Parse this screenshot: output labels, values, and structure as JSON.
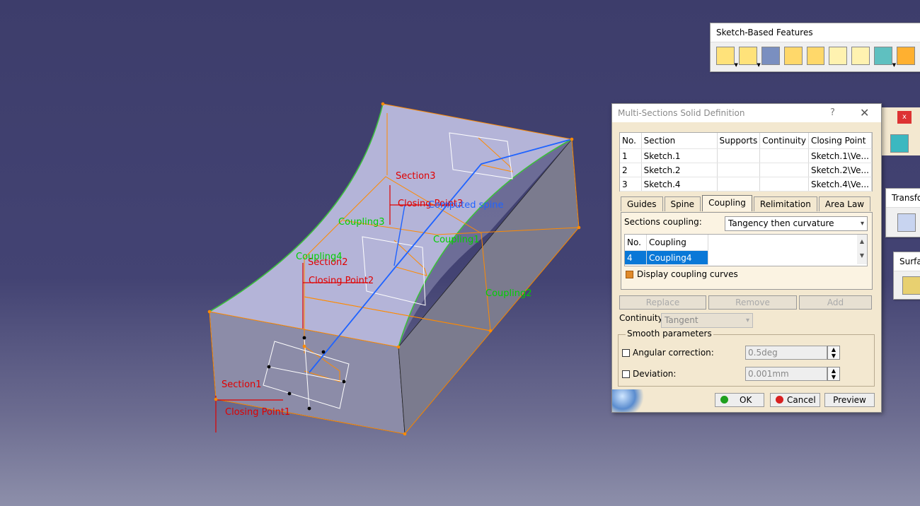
{
  "viewport": {
    "labels": {
      "section1": "Section1",
      "section2": "Section2",
      "section3": "Section3",
      "closing_point1": "Closing Point1",
      "closing_point2": "Closing Point2",
      "closing_point3": "Closing Point3",
      "computed_spine": "Computed spine",
      "coupling1": "Coupling1",
      "coupling2": "Coupling2",
      "coupling3": "Coupling3",
      "coupling4": "Coupling4"
    },
    "colors": {
      "section_label": "#e00000",
      "coupling_label": "#00d000",
      "spine": "#1f63ff",
      "edge": "#ff8a00"
    }
  },
  "toolbars": {
    "sketch_based": {
      "title": "Sketch-Based Features"
    },
    "transform": {
      "title": "Transfor"
    },
    "surface": {
      "title": "Surfac"
    },
    "small_close": "x"
  },
  "dialog": {
    "title": "Multi-Sections Solid Definition",
    "help": "?",
    "close": "✕",
    "table": {
      "headers": [
        "No.",
        "Section",
        "Supports",
        "Continuity",
        "Closing Point"
      ],
      "rows": [
        {
          "no": "1",
          "section": "Sketch.1",
          "supports": "",
          "continuity": "",
          "closing_point": "Sketch.1\\Ve..."
        },
        {
          "no": "2",
          "section": "Sketch.2",
          "supports": "",
          "continuity": "",
          "closing_point": "Sketch.2\\Ve..."
        },
        {
          "no": "3",
          "section": "Sketch.4",
          "supports": "",
          "continuity": "",
          "closing_point": "Sketch.4\\Ve..."
        }
      ]
    },
    "tabs": [
      "Guides",
      "Spine",
      "Coupling",
      "Relimitation",
      "Area Law"
    ],
    "active_tab": "Coupling",
    "coupling": {
      "sections_coupling_label": "Sections coupling:",
      "sections_coupling_value": "Tangency then curvature",
      "list_headers": [
        "No.",
        "Coupling"
      ],
      "list_rows": [
        {
          "no": "4",
          "coupling": "Coupling4"
        }
      ],
      "display_coupling_curves": "Display coupling curves"
    },
    "buttons": {
      "replace": "Replace",
      "remove": "Remove",
      "add": "Add"
    },
    "continuity_label": "Continuity:",
    "continuity_value": "Tangent",
    "smooth": {
      "title": "Smooth parameters",
      "angular_label": "Angular correction:",
      "angular_value": "0.5deg",
      "deviation_label": "Deviation:",
      "deviation_value": "0.001mm"
    },
    "footer": {
      "ok": "OK",
      "cancel": "Cancel",
      "preview": "Preview"
    }
  }
}
